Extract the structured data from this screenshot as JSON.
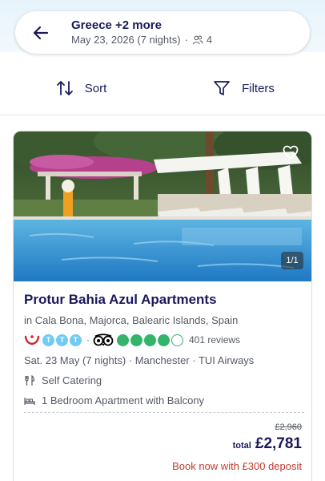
{
  "header": {
    "destination": "Greece +2 more",
    "date_nights": "May 23, 2026 (7 nights)",
    "travellers": "4"
  },
  "toolbar": {
    "sort_label": "Sort",
    "filters_label": "Filters"
  },
  "card": {
    "image_counter": "1/1",
    "hotel_name": "Protur Bahia Azul Apartments",
    "location": "in Cala Bona, Majorca, Balearic Islands, Spain",
    "tui_rating": 3,
    "tripadvisor_bubbles": 4,
    "tripadvisor_max": 5,
    "reviews": "401 reviews",
    "trip_line": "Sat. 23 May (7 nights) · Manchester · TUI Airways",
    "board": "Self Catering",
    "room": "1 Bedroom Apartment with Balcony",
    "old_price": "£2,960",
    "total_label": "total",
    "total_price": "£2,781",
    "deposit": "Book now with £300 deposit"
  },
  "colors": {
    "brand_navy": "#1a1a5a",
    "tui_red": "#d4262e",
    "tui_light_blue": "#70cbf4",
    "tripadvisor_green": "#34b36b",
    "deposit_red": "#c0392b"
  },
  "icons": [
    "back-arrow-icon",
    "people-icon",
    "sort-icon",
    "filter-icon",
    "heart-icon",
    "tui-logo-icon",
    "tripadvisor-owl-icon",
    "cutlery-icon",
    "bed-icon"
  ]
}
